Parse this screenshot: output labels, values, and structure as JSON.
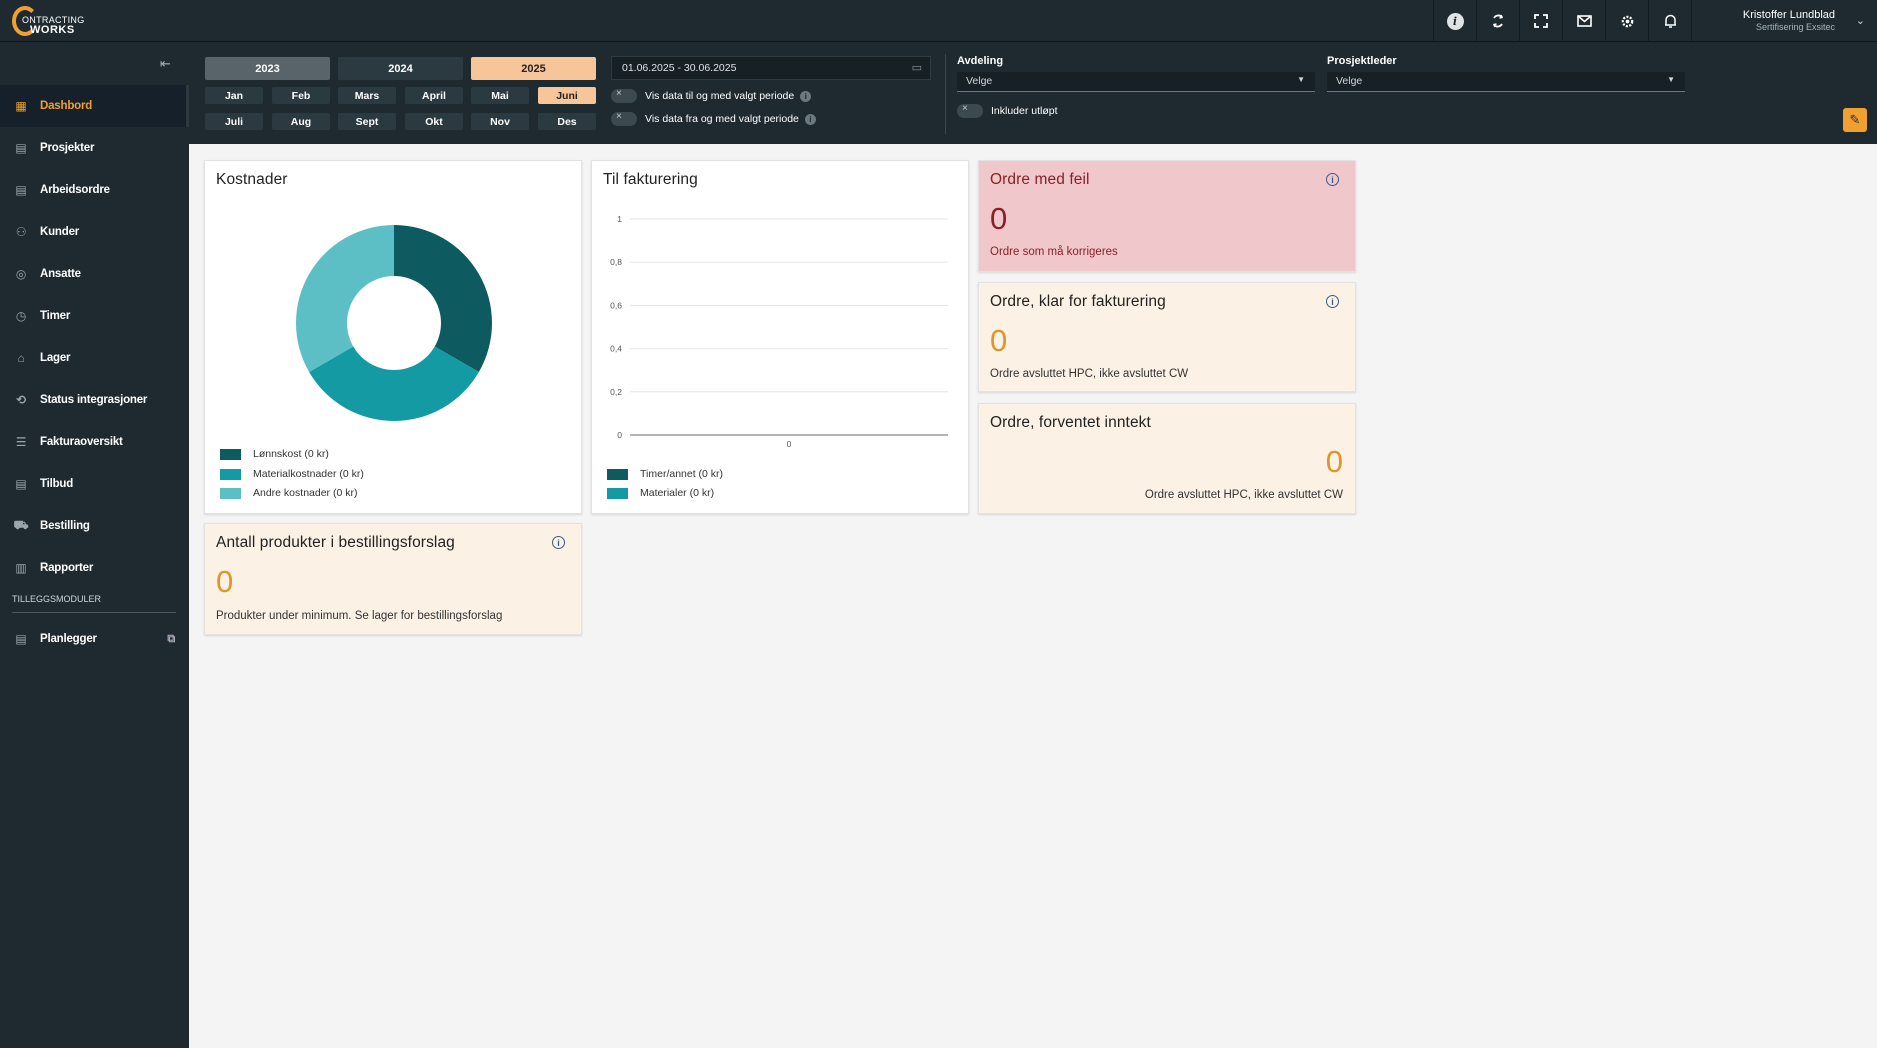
{
  "header": {
    "logo_top": "ONTRACTING",
    "logo_bottom": "WORKS",
    "icons": [
      "info-icon",
      "sync-icon",
      "fullscreen-icon",
      "mail-icon",
      "settings-icon",
      "bell-icon"
    ],
    "user_name": "Kristoffer Lundblad",
    "user_sub": "Sertifisering Exsitec"
  },
  "sidebar": {
    "items": [
      {
        "label": "Dashbord",
        "icon": "dashboard-icon"
      },
      {
        "label": "Prosjekter",
        "icon": "projects-icon"
      },
      {
        "label": "Arbeidsordre",
        "icon": "workorder-icon"
      },
      {
        "label": "Kunder",
        "icon": "customers-icon"
      },
      {
        "label": "Ansatte",
        "icon": "employees-icon"
      },
      {
        "label": "Timer",
        "icon": "clock-icon"
      },
      {
        "label": "Lager",
        "icon": "warehouse-icon"
      },
      {
        "label": "Status integrasjoner",
        "icon": "sync-icon"
      },
      {
        "label": "Fakturaoversikt",
        "icon": "invoice-icon"
      },
      {
        "label": "Tilbud",
        "icon": "offer-icon"
      },
      {
        "label": "Bestilling",
        "icon": "cart-icon"
      },
      {
        "label": "Rapporter",
        "icon": "reports-icon"
      }
    ],
    "addons_label": "TILLEGGSMODULER",
    "planner_label": "Planlegger"
  },
  "filters": {
    "years": [
      "2023",
      "2024",
      "2025"
    ],
    "months_row1": [
      "Jan",
      "Feb",
      "Mars",
      "April",
      "Mai",
      "Juni"
    ],
    "months_row2": [
      "Juli",
      "Aug",
      "Sept",
      "Okt",
      "Nov",
      "Des"
    ],
    "date_range": "01.06.2025 - 30.06.2025",
    "toggle_to": "Vis data til og med valgt periode",
    "toggle_from": "Vis data fra og med valgt periode",
    "department_label": "Avdeling",
    "department_value": "Velge",
    "include_expired": "Inkluder utløpt",
    "project_leader_label": "Prosjektleder",
    "project_leader_value": "Velge"
  },
  "cards": {
    "costs": {
      "title": "Kostnader",
      "legend": [
        "Lønnskost (0 kr)",
        "Materialkostnader (0 kr)",
        "Andre kostnader (0 kr)"
      ]
    },
    "invoicing": {
      "title": "Til fakturering",
      "legend": [
        "Timer/annet (0 kr)",
        "Materialer (0 kr)"
      ]
    },
    "errors": {
      "title": "Ordre med feil",
      "value": "0",
      "sub": "Ordre som må korrigeres"
    },
    "ready": {
      "title": "Ordre, klar for fakturering",
      "value": "0",
      "sub": "Ordre avsluttet HPC, ikke avsluttet CW"
    },
    "expected": {
      "title": "Ordre, forventet inntekt",
      "value": "0",
      "sub": "Ordre avsluttet HPC, ikke avsluttet CW"
    },
    "products": {
      "title": "Antall produkter i bestillingsforslag",
      "value": "0",
      "sub": "Produkter under minimum. Se lager for bestillingsforslag"
    }
  },
  "colors": {
    "accent": "#f0a030",
    "dark_teal": "#0d5a60",
    "teal": "#139aa3",
    "light_teal": "#5cbfc6"
  },
  "chart_data": [
    {
      "type": "pie",
      "title": "Kostnader",
      "categories": [
        "Lønnskost (0 kr)",
        "Materialkostnader (0 kr)",
        "Andre kostnader (0 kr)"
      ],
      "values": [
        1,
        1,
        1
      ],
      "colors": [
        "#0d5a60",
        "#139aa3",
        "#5cbfc6"
      ]
    },
    {
      "type": "bar",
      "title": "Til fakturering",
      "categories": [
        "0"
      ],
      "series": [
        {
          "name": "Timer/annet (0 kr)",
          "values": [
            0
          ]
        },
        {
          "name": "Materialer (0 kr)",
          "values": [
            0
          ]
        }
      ],
      "ylim": [
        0,
        1
      ],
      "yticks": [
        "1",
        "0,8",
        "0,6",
        "0,4",
        "0,2",
        "0"
      ],
      "grid": true
    }
  ]
}
